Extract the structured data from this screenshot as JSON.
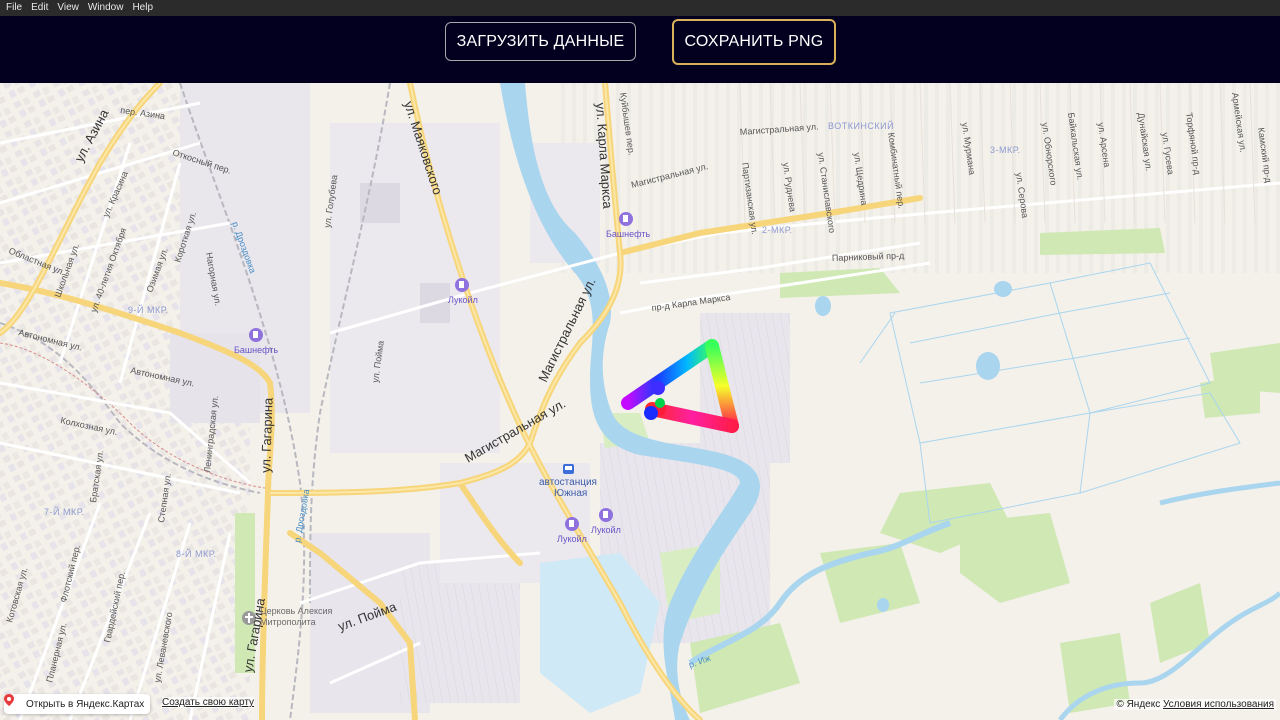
{
  "menu": {
    "items": [
      "File",
      "Edit",
      "View",
      "Window",
      "Help"
    ]
  },
  "toolbar": {
    "load_label": "ЗАГРУЗИТЬ ДАННЫЕ",
    "save_label": "СОХРАНИТЬ PNG"
  },
  "map": {
    "streets": {
      "azina": "ул. Азина",
      "mayakovskogo": "ул. Маяковского",
      "karla_marksa": "ул. Карла Маркса",
      "magistralnaya_1": "Магистральная ул.",
      "magistralnaya_2": "Магистральная ул.",
      "magistralnaya_3": "Магистральная ул.",
      "magistralnaya_4": "Магистральная ул.",
      "gagarina_1": "ул. Гагарина",
      "gagarina_2": "ул. Гагарина",
      "poyma_1": "ул. Пойма",
      "poyma_2": "ул. Пойма",
      "oblastnaya": "Областная ул.",
      "avtonomnaya_1": "Автономная ул.",
      "avtonomnaya_2": "Автономная ул.",
      "kolhoznaya": "Колхозная ул.",
      "shkolnaya": "Школьная ул.",
      "pr_karla_marksa": "пр-д Карла Маркса",
      "parnikovyy": "Парниковый пр-д",
      "golubeva": "ул. Голубева",
      "lenina_40": "ул. 40-летия Октября",
      "ozimaya": "Озимая ул.",
      "otkosnyy": "Откосный пер.",
      "azina_per": "пер. Азина",
      "krasina": "ул. Красина",
      "korotkaya": "Короткая ул.",
      "nagornaya": "Нагорная ул.",
      "leningradskaya": "Ленинградская ул.",
      "bratskaya": "Братская ул.",
      "stepnaya": "Степная ул.",
      "flotskiy": "Флотский пер.",
      "gvardeyskiy": "Гвардейский пер.",
      "levanevskogo": "ул. Леваневского",
      "planernaya": "Планерная ул.",
      "kotovskogo": "Котовская ул.",
      "ryadneva": "ул. Руднева",
      "stanislavskogo": "ул. Станиславского",
      "partizanskaya": "Партизанская ул.",
      "shedrina": "ул. Щедрина",
      "kombinatnyy": "Комбинатный пер.",
      "murmana": "ул. Мурмана",
      "serova": "ул. Серова",
      "obnorskogo": "ул. Обнорского",
      "baikalskaya": "Байкальская ул.",
      "arsena": "ул. Арсена",
      "dunaiskaya": "Дунайская ул.",
      "guseva": "ул. Гусева",
      "torfyanoy": "Торфяной пр-д",
      "armeyskaya": "Армейская ул.",
      "kamskiy": "Камский пр-д",
      "kuybyshev": "Куйбышев пер."
    },
    "districts": {
      "votkinskiy": "ВОТКИНСКИЙ",
      "mkr_2": "2-МКР.",
      "mkr_3": "3-МКР.",
      "mkr_7": "7-Й МКР.",
      "mkr_8": "8-Й МКР.",
      "mkr_9": "9-Й МКР."
    },
    "pois": {
      "bashneft_1": "Башнефть",
      "bashneft_2": "Башнефть",
      "lukoil_1": "Лукойл",
      "lukoil_2": "Лукойл",
      "lukoil_3": "Лукойл",
      "bus_station_1": "автостанция",
      "bus_station_2": "Южная",
      "church_1": "Церковь Алексия",
      "church_2": "Митрополита"
    },
    "rivers": {
      "drozdovka_1": "р. Дроздовка",
      "drozdovka_2": "р. Дроздовка",
      "izh": "р. Иж"
    },
    "footer": {
      "open_in_yandex": "Открыть в Яндекс.Картах",
      "create_map": "Создать свою карту",
      "copyright_prefix": "© Яндекс",
      "terms": "Условия использования"
    }
  },
  "colors": {
    "menubar_bg": "#2b2b2b",
    "toolbar_bg": "#03001f",
    "save_border": "#d8b15a",
    "load_border": "#a8a8a8",
    "map_bg": "#f4f1ea",
    "road_major": "#f7d57a",
    "water": "#a9d5ef",
    "park": "#cfe8b4"
  }
}
